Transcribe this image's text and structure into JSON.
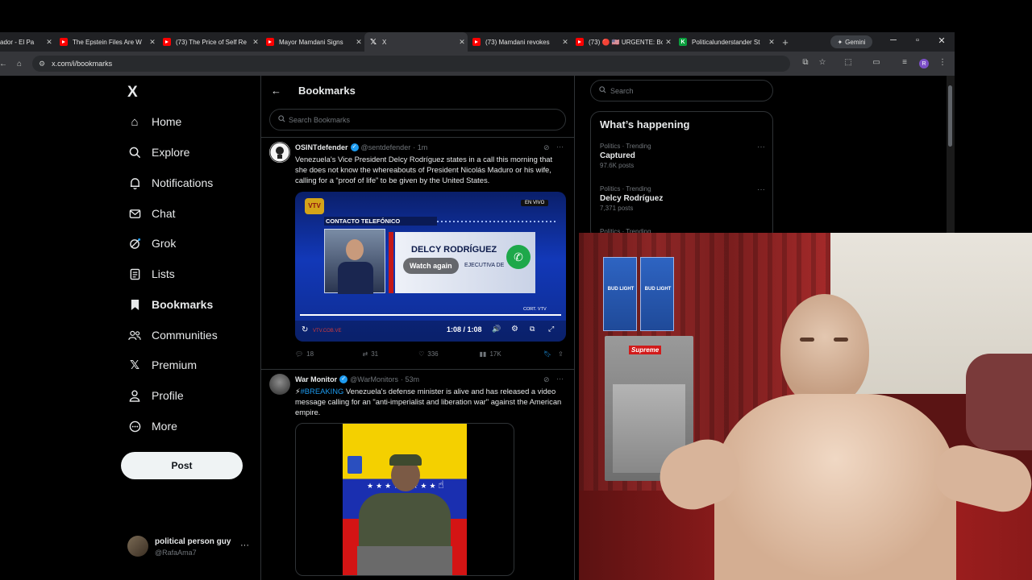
{
  "browser": {
    "tabs": [
      {
        "title": "ador - El Pa",
        "icon": "youtube-icon",
        "active": false
      },
      {
        "title": "The Epstein Files Are W",
        "icon": "youtube-icon",
        "active": false
      },
      {
        "title": "(73) The Price of Self Re",
        "icon": "youtube-icon",
        "active": false
      },
      {
        "title": "Mayor Mamdani Signs",
        "icon": "youtube-icon",
        "active": false
      },
      {
        "title": "X",
        "icon": "x-icon",
        "active": true
      },
      {
        "title": "(73) Mamdani revokes",
        "icon": "youtube-icon",
        "active": false
      },
      {
        "title": "(73) 🔴 🇺🇸 URGENTE: Bo",
        "icon": "youtube-icon",
        "active": false
      },
      {
        "title": "Politicalunderstander St",
        "icon": "app-icon",
        "active": false
      }
    ],
    "new_tab": "+",
    "gemini_label": "Gemini",
    "url": "x.com/i/bookmarks",
    "profile_initial": "R",
    "colors": {
      "tabstrip": "#202124",
      "toolbar": "#35363a",
      "accent": "#1d9bf0"
    }
  },
  "sidebar": {
    "logo": "X",
    "items": [
      {
        "label": "Home",
        "icon": "home-icon"
      },
      {
        "label": "Explore",
        "icon": "search-icon"
      },
      {
        "label": "Notifications",
        "icon": "bell-icon"
      },
      {
        "label": "Chat",
        "icon": "mail-icon"
      },
      {
        "label": "Grok",
        "icon": "grok-icon"
      },
      {
        "label": "Lists",
        "icon": "list-icon"
      },
      {
        "label": "Bookmarks",
        "icon": "bookmark-icon"
      },
      {
        "label": "Communities",
        "icon": "people-icon"
      },
      {
        "label": "Premium",
        "icon": "x-icon"
      },
      {
        "label": "Profile",
        "icon": "person-icon"
      },
      {
        "label": "More",
        "icon": "more-circle-icon"
      }
    ],
    "post_button": "Post",
    "account": {
      "name": "political person guy",
      "handle": "@RafaAma7"
    }
  },
  "bookmarks": {
    "title": "Bookmarks",
    "search_placeholder": "Search Bookmarks",
    "posts": [
      {
        "name": "OSINTdefender",
        "handle": "@sentdefender",
        "time": "· 1m",
        "text": "Venezuela’s Vice President Delcy Rodríguez states in a call this morning that she does not know the whereabouts of President Nicolás Maduro or his wife, calling for a “proof of life” to be given by the United States.",
        "media": {
          "live_badge": "EN VIVO",
          "banner": "CONTACTO TELEFÓNICO",
          "caller_name": "DELCY RODRÍGUEZ",
          "caller_sub": "EJECUTIVA DE",
          "watch_again": "Watch again",
          "time": "1:08 / 1:08",
          "credit": "CORT. VTV",
          "site": "VTV.COB.VE"
        },
        "stats": {
          "replies": "18",
          "reposts": "31",
          "likes": "336",
          "views": "17K"
        }
      },
      {
        "name": "War Monitor",
        "handle": "@WarMonitors",
        "time": "· 53m",
        "text_prefix": "⚡",
        "hashtag": "#BREAKING",
        "text": " Venezuela's defense minister is alive and has released a video message calling for an \"anti-imperialist and liberation war\" against the American empire."
      }
    ]
  },
  "right": {
    "search_placeholder": "Search",
    "happening_title": "What’s happening",
    "trends": [
      {
        "context": "Politics · Trending",
        "name": "Captured",
        "count": "97.6K posts"
      },
      {
        "context": "Politics · Trending",
        "name": "Delcy Rodríguez",
        "count": "7,371 posts"
      },
      {
        "context": "Politics · Trending",
        "name": "",
        "count": ""
      }
    ]
  },
  "webcam": {
    "poster_text": "Supreme",
    "box_text": "BUD LIGHT"
  }
}
